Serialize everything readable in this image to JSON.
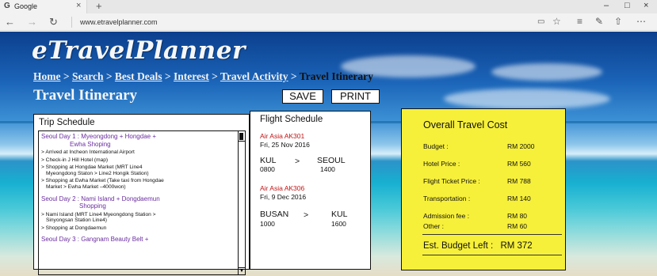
{
  "browser": {
    "tab_title": "Google",
    "tab_close": "×",
    "new_tab": "+",
    "url": "www.etravelplanner.com",
    "icons": [
      "back-arrow-icon",
      "forward-arrow-icon",
      "refresh-icon",
      "reading-view-icon",
      "favorite-star-icon",
      "hub-icon",
      "web-note-icon",
      "share-icon",
      "more-icon"
    ],
    "window_minimize": "–",
    "window_maximize": "□",
    "window_close": "×"
  },
  "site": {
    "logo": "eTravelPlanner",
    "breadcrumb": [
      {
        "label": "Home"
      },
      {
        "label": "Search"
      },
      {
        "label": "Best Deals"
      },
      {
        "label": "Interest"
      },
      {
        "label": "Travel Activity"
      }
    ],
    "breadcrumb_separator": " > ",
    "breadcrumb_current": "Travel Itinerary",
    "page_title": "Travel Itinerary",
    "save_label": "SAVE",
    "print_label": "PRINT"
  },
  "trip": {
    "title": "Trip Schedule",
    "day1": {
      "head1": "Seoul Day 1 : Myeongdong + Hongdae +",
      "head2": "Ewha Shoping",
      "items": [
        "> Arrived at Incheon International Airport",
        "> Check-in J Hill Hotel (map)",
        "> Shopping at Hongdae Market (MRT Line4",
        "Myeongdong Staton > Line2 Hongik Station)",
        "> Shopping at Ewha Market (Take taxi from Hongdae",
        "Market > Ewha Market –4000won)"
      ]
    },
    "day2": {
      "head1": "Seoul Day 2 : Nami Island + Dongdaemun",
      "head2": "Shopping",
      "items": [
        "> Nami Island (MRT Line4 Myeongdong Station >",
        "Sinyongsan Station Line4)",
        "> Shopping at Dongdaemun"
      ]
    },
    "day3": {
      "head1": "Seoul Day 3 : Gangnam Beauty Belt +"
    },
    "scroll_down": "▼"
  },
  "flight": {
    "title": "Flight Schedule",
    "f1": {
      "airline": "Air Asia  AK301",
      "date": "Fri, 25 Nov 2016",
      "from": "KUL",
      "arrow": ">",
      "to": "SEOUL",
      "dep": "0800",
      "arr": "1400"
    },
    "f2": {
      "airline": "Air Asia  AK306",
      "date": "Fri, 9 Dec 2016",
      "from": "BUSAN",
      "arrow": ">",
      "to": "KUL",
      "dep": "1000",
      "arr": "1600"
    }
  },
  "cost": {
    "title": "Overall Travel Cost",
    "rows": [
      {
        "label": "Budget :",
        "value": "RM 2000"
      },
      {
        "label": "Hotel Price :",
        "value": "RM 560"
      },
      {
        "label": "Flight Ticket Price :",
        "value": "RM 788"
      },
      {
        "label": "Transportation :",
        "value": "RM 140"
      },
      {
        "label": "Admission fee :",
        "value": "RM 80"
      },
      {
        "label": "Other :",
        "value": "RM 60"
      }
    ],
    "total_label": "Est. Budget Left :",
    "total_value": "RM 372"
  },
  "colors": {
    "cost_panel": "#f7f03a",
    "day_heading": "#6b2fa0",
    "airline": "#c01515"
  }
}
